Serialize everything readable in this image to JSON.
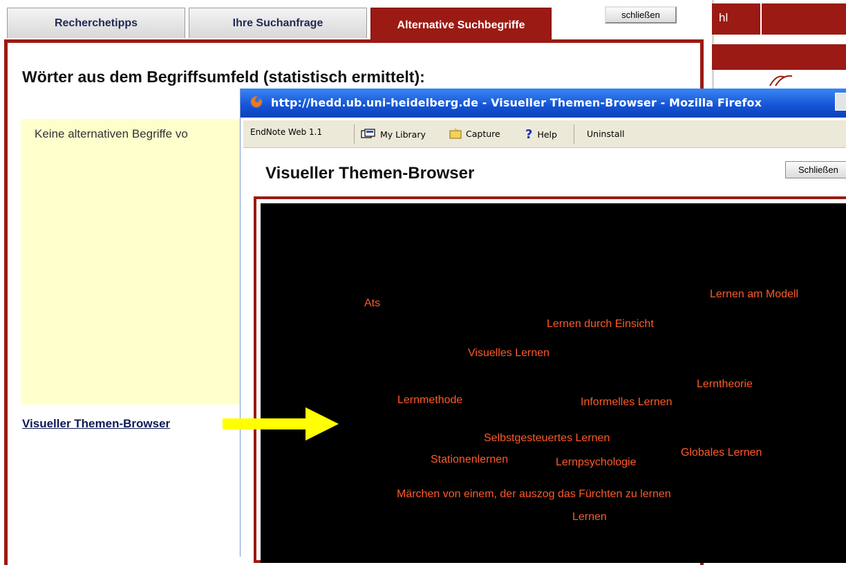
{
  "tabs": [
    {
      "label": "Recherchetipps"
    },
    {
      "label": "Ihre Suchanfrage"
    },
    {
      "label": "Alternative Suchbegriffe"
    }
  ],
  "close_button": "schließen",
  "main": {
    "heading": "Wörter aus dem Begriffsumfeld (statistisch ermittelt):",
    "no_alternatives_text": "Keine alternativen Begriffe vo",
    "visual_browser_link": "Visueller Themen-Browser"
  },
  "right_panel": {
    "partial_text": "hl"
  },
  "firefox": {
    "title": "http://hedd.ub.uni-heidelberg.de - Visueller Themen-Browser - Mozilla Firefox",
    "toolbar": {
      "endnote_label": "EndNote Web 1.1",
      "my_library": "My Library",
      "capture": "Capture",
      "help": "Help",
      "uninstall": "Uninstall"
    },
    "page_title": "Visueller Themen-Browser",
    "close_button": "Schließen"
  },
  "topics": [
    "Ats",
    "Lernen am Modell",
    "Lernen durch Einsicht",
    "Visuelles Lernen",
    "Lerntheorie",
    "Lernmethode",
    "Informelles Lernen",
    "Selbstgesteuertes Lernen",
    "Stationenlernen",
    "Lernpsychologie",
    "Globales Lernen",
    "Märchen von einem, der auszog das Fürchten zu lernen",
    "Lernen"
  ],
  "colors": {
    "accent_red": "#9b1a13",
    "topic_orange": "#ff5a28",
    "highlight_yellow": "#ffff00",
    "note_yellow": "#ffffcc"
  }
}
